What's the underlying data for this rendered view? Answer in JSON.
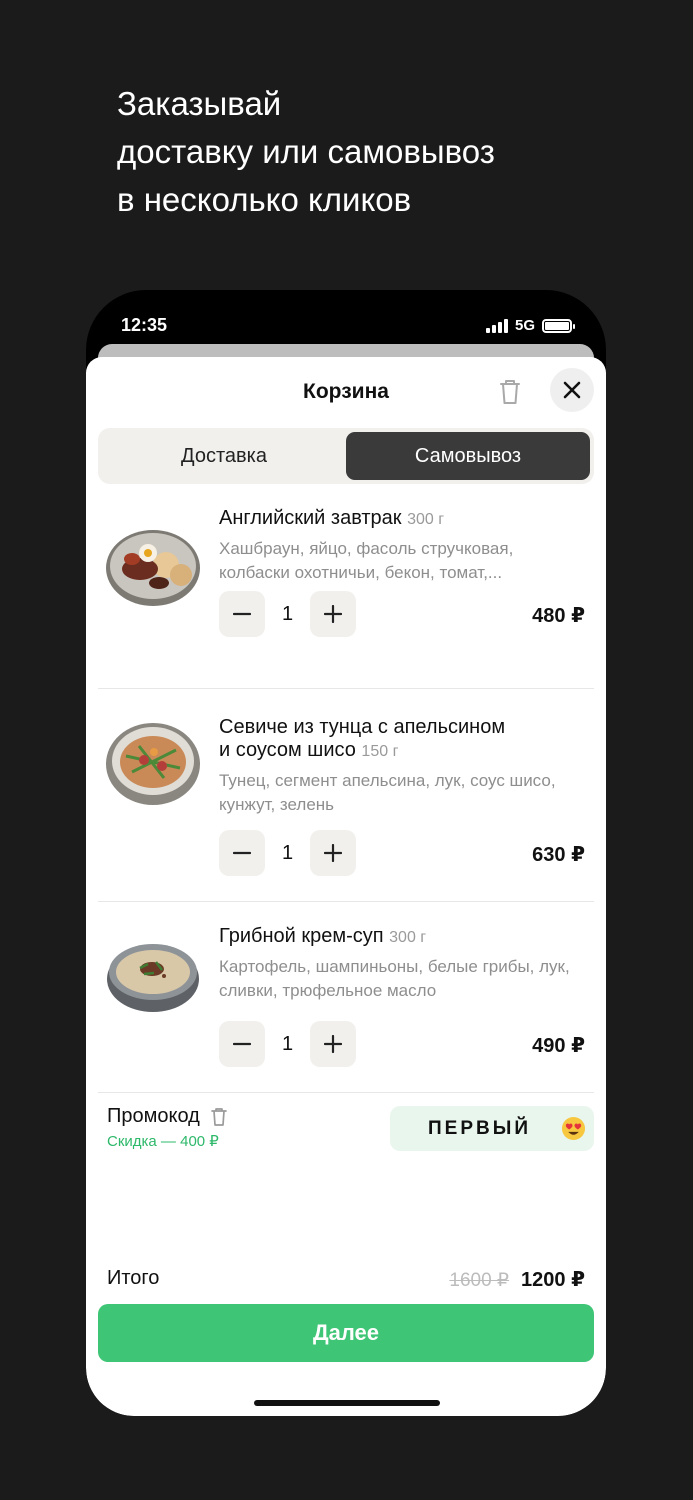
{
  "promo": {
    "line1": "Заказывай",
    "line2": "доставку или самовывоз",
    "line3": "в несколько кликов"
  },
  "status_bar": {
    "time": "12:35",
    "network": "5G"
  },
  "cart": {
    "title": "Корзина",
    "tabs": [
      {
        "label": "Доставка",
        "active": false
      },
      {
        "label": "Самовывоз",
        "active": true
      }
    ],
    "items": [
      {
        "name": "Английский завтрак",
        "weight": "300 г",
        "description": "Хашбраун, яйцо, фасоль стручковая, колбаски охотничьи, бекон, томат,...",
        "quantity": "1",
        "price": "480 ₽"
      },
      {
        "name_line1": "Севиче из тунца с апельсином",
        "name_line2": "и соусом шисо",
        "weight": "150 г",
        "description": "Тунец, сегмент апельсина, лук, соус шисо, кунжут, зелень",
        "quantity": "1",
        "price": "630 ₽"
      },
      {
        "name": "Грибной крем-суп",
        "weight": "300 г",
        "description": "Картофель, шампиньоны, белые грибы, лук, сливки, трюфельное масло",
        "quantity": "1",
        "price": "490 ₽"
      }
    ],
    "promo_label": "Промокод",
    "promo_discount": "Скидка — 400 ₽",
    "promo_code": "ПЕРВЫЙ",
    "total_label": "Итого",
    "total_old": "1600 ₽",
    "total_new": "1200 ₽",
    "next_button": "Далее"
  },
  "colors": {
    "accent": "#3ec576",
    "discount": "#2eb86a",
    "background": "#1b1b1b"
  }
}
